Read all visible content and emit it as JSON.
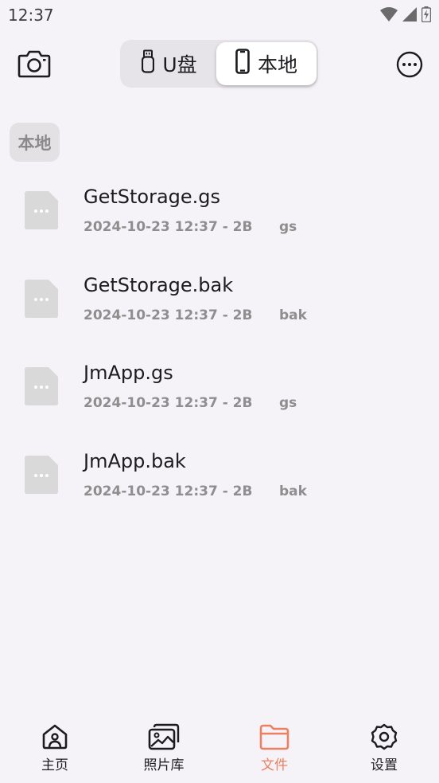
{
  "status_bar": {
    "time": "12:37"
  },
  "top_bar": {
    "segments": [
      {
        "label": "U盘",
        "icon": "usb-drive-icon",
        "selected": false
      },
      {
        "label": "本地",
        "icon": "phone-icon",
        "selected": true
      }
    ]
  },
  "section": {
    "label": "本地"
  },
  "files": [
    {
      "name": "GetStorage.gs",
      "meta": "2024-10-23 12:37 - 2B",
      "ext": "gs",
      "icon": "file-more-icon"
    },
    {
      "name": "GetStorage.bak",
      "meta": "2024-10-23 12:37 - 2B",
      "ext": "bak",
      "icon": "file-more-icon"
    },
    {
      "name": "JmApp.gs",
      "meta": "2024-10-23 12:37 - 2B",
      "ext": "gs",
      "icon": "file-more-icon"
    },
    {
      "name": "JmApp.bak",
      "meta": "2024-10-23 12:37 - 2B",
      "ext": "bak",
      "icon": "file-more-icon"
    }
  ],
  "bottom_nav": {
    "items": [
      {
        "label": "主页",
        "icon": "home-icon",
        "active": false
      },
      {
        "label": "照片库",
        "icon": "gallery-icon",
        "active": false
      },
      {
        "label": "文件",
        "icon": "folder-icon",
        "active": true
      },
      {
        "label": "设置",
        "icon": "gear-icon",
        "active": false
      }
    ]
  },
  "colors": {
    "background": "#f5f3f7",
    "accent": "#ec8062",
    "file_icon": "#d9d9d9",
    "meta_text": "#8e8e8e"
  }
}
